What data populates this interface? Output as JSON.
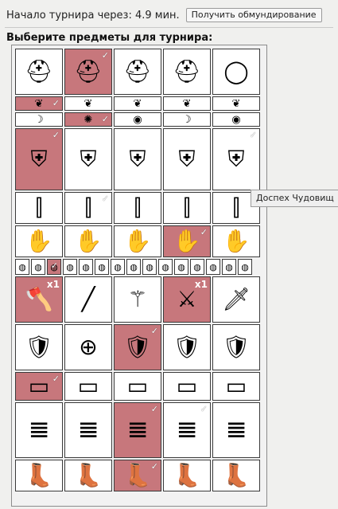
{
  "header": {
    "countdown_label": "Начало турнира через: 4.9 мин.",
    "equip_button": "Получить обмундирование"
  },
  "title": "Выберите предметы для турнира:",
  "tooltip": "Доспех Чудовищ",
  "colors": {
    "selected_bg": "#c7777c",
    "cell_bg": "#ffffff",
    "border": "#3a3a3a"
  },
  "rows": [
    {
      "name": "helmets",
      "items": [
        {
          "icon": "helmet-icon",
          "glyph": "⛑",
          "sel": false
        },
        {
          "icon": "helmet-icon",
          "glyph": "⛑",
          "sel": true,
          "check": "✓"
        },
        {
          "icon": "horned-helmet-icon",
          "glyph": "⛑",
          "sel": false
        },
        {
          "icon": "helmet-icon",
          "glyph": "⛑",
          "sel": false
        },
        {
          "icon": "circlet-icon",
          "glyph": "◯",
          "sel": false
        }
      ]
    },
    {
      "name": "earrings",
      "items": [
        {
          "icon": "earring-icon",
          "glyph": "❦",
          "sel": true,
          "check": "✓"
        },
        {
          "icon": "earring-icon",
          "glyph": "❦",
          "sel": false
        },
        {
          "icon": "earring-icon",
          "glyph": "❦",
          "sel": false
        },
        {
          "icon": "earring-icon",
          "glyph": "❦",
          "sel": false
        },
        {
          "icon": "earring-icon",
          "glyph": "❦",
          "sel": false
        }
      ]
    },
    {
      "name": "amulets",
      "items": [
        {
          "icon": "amulet-icon",
          "glyph": "☽",
          "sel": false
        },
        {
          "icon": "amulet-icon",
          "glyph": "✺",
          "sel": true,
          "check": "✓"
        },
        {
          "icon": "amulet-icon",
          "glyph": "◉",
          "sel": false
        },
        {
          "icon": "amulet-icon",
          "glyph": "☽",
          "sel": false
        },
        {
          "icon": "amulet-icon",
          "glyph": "◉",
          "sel": false
        }
      ]
    },
    {
      "name": "armor",
      "items": [
        {
          "icon": "chest-armor-icon",
          "glyph": "⛨",
          "sel": true,
          "check": "✓"
        },
        {
          "icon": "chest-armor-icon",
          "glyph": "⛨",
          "sel": false
        },
        {
          "icon": "chest-armor-icon",
          "glyph": "⛨",
          "sel": false
        },
        {
          "icon": "chest-armor-icon",
          "glyph": "⛨",
          "sel": false
        },
        {
          "icon": "chest-armor-icon",
          "glyph": "⛨",
          "sel": false,
          "check": "✓"
        }
      ]
    },
    {
      "name": "bracers",
      "items": [
        {
          "icon": "bracers-icon",
          "glyph": "⫿",
          "sel": false
        },
        {
          "icon": "bracers-icon",
          "glyph": "⫿",
          "sel": false,
          "check": "✓"
        },
        {
          "icon": "bracers-icon",
          "glyph": "⫿",
          "sel": false
        },
        {
          "icon": "bracers-icon",
          "glyph": "⫿",
          "sel": false
        },
        {
          "icon": "bracers-icon",
          "glyph": "⫿",
          "sel": false
        }
      ]
    },
    {
      "name": "gloves",
      "items": [
        {
          "icon": "gloves-icon",
          "glyph": "✋",
          "sel": false
        },
        {
          "icon": "gloves-icon",
          "glyph": "✋",
          "sel": false
        },
        {
          "icon": "gloves-icon",
          "glyph": "✋",
          "sel": false
        },
        {
          "icon": "gloves-icon",
          "glyph": "✋",
          "sel": true,
          "check": "✓"
        },
        {
          "icon": "gloves-icon",
          "glyph": "✋",
          "sel": false
        }
      ]
    },
    {
      "name": "rings",
      "items": [
        {
          "icon": "ring-icon",
          "glyph": "◍",
          "sel": false
        },
        {
          "icon": "ring-icon",
          "glyph": "◍",
          "sel": false
        },
        {
          "icon": "ring-icon",
          "glyph": "◍",
          "sel": true,
          "check": "✓"
        },
        {
          "icon": "ring-icon",
          "glyph": "◍",
          "sel": false
        },
        {
          "icon": "ring-icon",
          "glyph": "◍",
          "sel": false
        },
        {
          "icon": "ring-icon",
          "glyph": "◍",
          "sel": false
        },
        {
          "icon": "ring-icon",
          "glyph": "◍",
          "sel": false
        },
        {
          "icon": "ring-icon",
          "glyph": "◍",
          "sel": false
        },
        {
          "icon": "ring-icon",
          "glyph": "◍",
          "sel": false
        },
        {
          "icon": "ring-icon",
          "glyph": "◍",
          "sel": false
        },
        {
          "icon": "ring-icon",
          "glyph": "◍",
          "sel": false
        },
        {
          "icon": "ring-icon",
          "glyph": "◍",
          "sel": false
        },
        {
          "icon": "ring-icon",
          "glyph": "◍",
          "sel": false
        },
        {
          "icon": "ring-icon",
          "glyph": "◍",
          "sel": false
        },
        {
          "icon": "ring-icon",
          "glyph": "◍",
          "sel": false
        }
      ]
    },
    {
      "name": "weapons",
      "items": [
        {
          "icon": "axe-icon",
          "glyph": "🪓",
          "sel": true,
          "qty": "x1"
        },
        {
          "icon": "staff-icon",
          "glyph": "╱",
          "sel": false
        },
        {
          "icon": "flail-icon",
          "glyph": "⚚",
          "sel": false
        },
        {
          "icon": "sword-icon",
          "glyph": "⚔",
          "sel": true,
          "qty": "x1"
        },
        {
          "icon": "sword-icon",
          "glyph": "🗡",
          "sel": false
        }
      ]
    },
    {
      "name": "shields",
      "items": [
        {
          "icon": "shield-icon",
          "glyph": "🛡",
          "sel": false
        },
        {
          "icon": "round-shield-icon",
          "glyph": "⊕",
          "sel": false
        },
        {
          "icon": "shield-icon",
          "glyph": "🛡",
          "sel": true,
          "check": "✓"
        },
        {
          "icon": "shield-icon",
          "glyph": "🛡",
          "sel": false
        },
        {
          "icon": "shield-icon",
          "glyph": "🛡",
          "sel": false
        }
      ]
    },
    {
      "name": "belts",
      "items": [
        {
          "icon": "belt-icon",
          "glyph": "▭",
          "sel": true,
          "check": "✓"
        },
        {
          "icon": "belt-icon",
          "glyph": "▭",
          "sel": false
        },
        {
          "icon": "belt-icon",
          "glyph": "▭",
          "sel": false
        },
        {
          "icon": "belt-icon",
          "glyph": "▭",
          "sel": false
        },
        {
          "icon": "belt-icon",
          "glyph": "▭",
          "sel": false
        }
      ]
    },
    {
      "name": "pants",
      "items": [
        {
          "icon": "pants-icon",
          "glyph": "𝌆",
          "sel": false
        },
        {
          "icon": "pants-icon",
          "glyph": "𝌆",
          "sel": false
        },
        {
          "icon": "pants-icon",
          "glyph": "𝌆",
          "sel": true,
          "check": "✓"
        },
        {
          "icon": "pants-icon",
          "glyph": "𝌆",
          "sel": false,
          "check": "✓"
        },
        {
          "icon": "pants-icon",
          "glyph": "𝌆",
          "sel": false
        }
      ]
    },
    {
      "name": "boots",
      "items": [
        {
          "icon": "boots-icon",
          "glyph": "👢",
          "sel": false
        },
        {
          "icon": "boots-icon",
          "glyph": "👢",
          "sel": false
        },
        {
          "icon": "boots-icon",
          "glyph": "👢",
          "sel": true,
          "check": "✓"
        },
        {
          "icon": "boots-icon",
          "glyph": "👢",
          "sel": false
        },
        {
          "icon": "boots-icon",
          "glyph": "👢",
          "sel": false
        }
      ]
    }
  ]
}
